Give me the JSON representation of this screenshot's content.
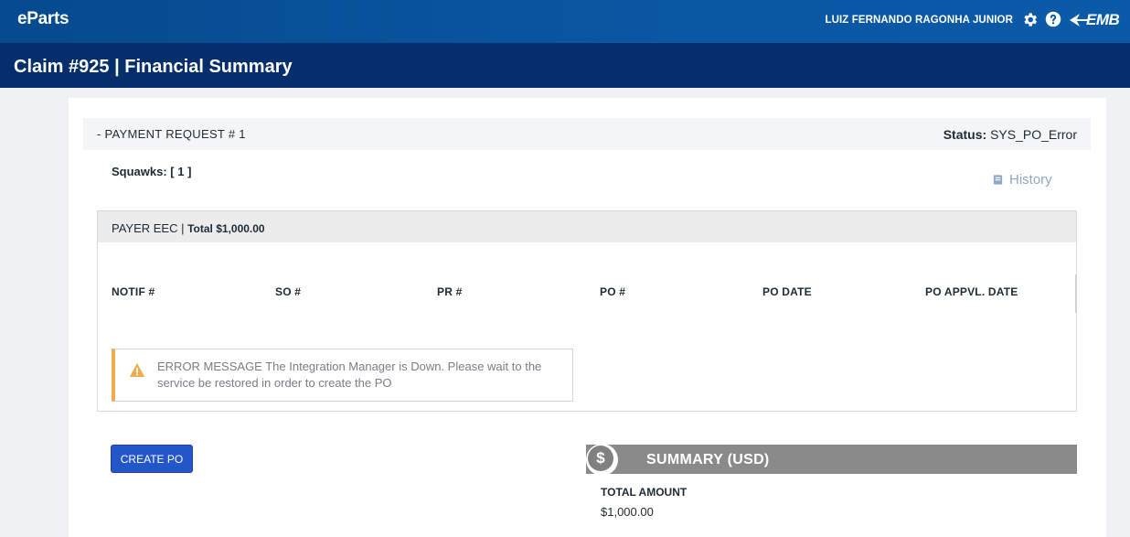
{
  "app": {
    "brand": "eParts",
    "user_name": "LUIZ FERNANDO RAGONHA JUNIOR",
    "logo_text": "EMB"
  },
  "page": {
    "title": "Claim #925 | Financial Summary"
  },
  "payment_request": {
    "title": "- PAYMENT REQUEST # 1",
    "status_label": "Status:",
    "status_value": "SYS_PO_Error",
    "squawks": "Squawks: [ 1 ]",
    "history_label": "History"
  },
  "payer": {
    "name": "PAYER EEC |",
    "total": "Total $1,000.00",
    "columns": [
      "NOTIF #",
      "SO #",
      "PR #",
      "PO #",
      "PO DATE",
      "PO APPVL. DATE"
    ],
    "error_message": "ERROR MESSAGE The Integration Manager is Down. Please wait to the service be restored in order to create the PO"
  },
  "actions": {
    "create_po_label": "CREATE PO"
  },
  "summary": {
    "coin_symbol": "$",
    "title": "SUMMARY (USD)",
    "total_amount_label": "TOTAL AMOUNT",
    "total_amount_value": "$1,000.00"
  },
  "colors": {
    "topbar": "#0a57a3",
    "titlebar": "#052e6b",
    "primary_button": "#2357c9",
    "warning": "#f0ad4e",
    "summary_bar": "#8a8a8a",
    "history_link": "#8fa8c8"
  },
  "icons": [
    "gear-icon",
    "help-icon",
    "embraer-logo-icon",
    "book-icon",
    "warning-icon",
    "dollar-icon"
  ]
}
